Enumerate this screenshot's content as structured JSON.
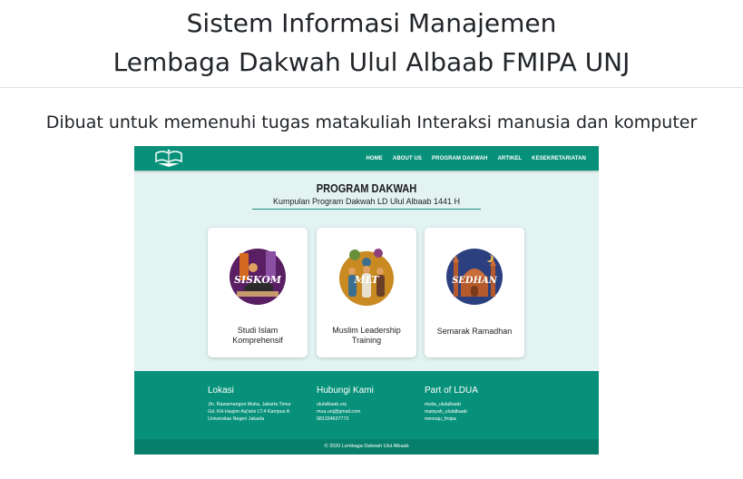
{
  "header": {
    "title_line1": "Sistem Informasi Manajemen",
    "title_line2": "Lembaga Dakwah Ulul Albaab FMIPA UNJ"
  },
  "subtitle": "Dibuat untuk memenuhi tugas matakuliah Interaksi manusia dan komputer",
  "screenshot": {
    "nav": {
      "logo_icon": "open-quran-logo-icon",
      "links": [
        "HOME",
        "ABOUT US",
        "PROGRAM DAKWAH",
        "ARTIKEL",
        "KESEKRETARIATAN"
      ]
    },
    "page_title": "PROGRAM DAKWAH",
    "page_subtitle": "Kumpulan Program Dakwah LD Ulul Albaab 1441 H",
    "cards": [
      {
        "badge": "SISKOM",
        "caption_line1": "Studi Islam",
        "caption_line2": "Komprehensif",
        "color": "#5a1e63",
        "icon": "studying-student-illustration"
      },
      {
        "badge": "MLT",
        "caption_line1": "Muslim Leadership",
        "caption_line2": "Training",
        "color": "#c98a22",
        "icon": "team-meeting-illustration"
      },
      {
        "badge": "SEDHAN",
        "caption_line1": "Semarak Ramadhan",
        "caption_line2": "",
        "color": "#2c3f7f",
        "icon": "mosque-night-illustration"
      }
    ],
    "footer": {
      "lokasi": {
        "title": "Lokasi",
        "lines": [
          "Jln. Rawamangun Muka, Jakarta Timur",
          "Gd. KH.Hasjim Asj'arie LT.4 Kampus A",
          "Universitas Negeri Jakarta"
        ]
      },
      "hubungi": {
        "title": "Hubungi Kami",
        "lines": [
          "ululalbaab.unj",
          "mua.unj@gmail.com",
          "081334637773"
        ]
      },
      "part": {
        "title": "Part of LDUA",
        "lines": [
          "mutia_ululalbaab",
          "maisyah_ululalbaab",
          "mensqu_fmipa"
        ]
      }
    },
    "copyright": "© 2020 Lembaga Dakwah Ulul Albaab"
  },
  "colors": {
    "teal": "#08917a",
    "teal_dark": "#07806b",
    "bg": "#e2f3f1"
  }
}
